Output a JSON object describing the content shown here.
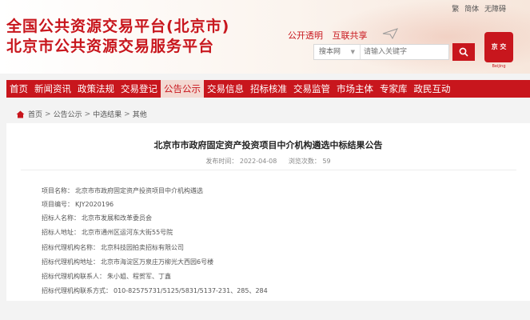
{
  "header": {
    "title_line1": "全国公共资源交易平台(北京市)",
    "title_line2": "北京市公共资源交易服务平台",
    "top_links": [
      "繁",
      "简体",
      "无障碍"
    ],
    "slogan": [
      "公开透明",
      "互联共享"
    ],
    "search": {
      "scope_value": "搜本网",
      "placeholder": "请输入关键字"
    },
    "seal_text": "京 交",
    "seal_caption": "Beijing"
  },
  "nav": {
    "items": [
      {
        "label": "首页"
      },
      {
        "label": "新闻资讯"
      },
      {
        "label": "政策法规"
      },
      {
        "label": "交易登记"
      },
      {
        "label": "公告公示",
        "active": true
      },
      {
        "label": "交易信息"
      },
      {
        "label": "招标核准"
      },
      {
        "label": "交易监管"
      },
      {
        "label": "市场主体"
      },
      {
        "label": "专家库"
      },
      {
        "label": "政民互动"
      }
    ]
  },
  "breadcrumb": [
    "首页",
    "公告公示",
    "中选结果",
    "其他"
  ],
  "article": {
    "title": "北京市市政府固定资产投资项目中介机构遴选中标结果公告",
    "publish_date": "发布时间： 2022-04-08",
    "views": "浏览次数： 59",
    "fields": [
      {
        "label": "项目名称：",
        "value": "北京市市政府固定资产投资项目中介机构遴选"
      },
      {
        "label": "项目编号：",
        "value": "KJY2020196"
      },
      {
        "label": "招标人名称：",
        "value": "北京市发展和改革委员会"
      },
      {
        "label": "招标人地址：",
        "value": "北京市通州区运河东大街55号院"
      },
      {
        "label": "招标代理机构名称：",
        "value": "北京科技园拍卖招标有限公司"
      },
      {
        "label": "招标代理机构地址：",
        "value": "北京市海淀区万泉庄万柳光大西园6号楼"
      },
      {
        "label": "招标代理机构联系人：",
        "value": "朱小姐、程贺军、丁鑫"
      },
      {
        "label": "招标代理机构联系方式：",
        "value": "010-82575731/5125/5831/5137-231、285、284"
      }
    ]
  },
  "colors": {
    "brand_red": "#c8161d",
    "nav_active_bg": "#f3d9d2"
  }
}
